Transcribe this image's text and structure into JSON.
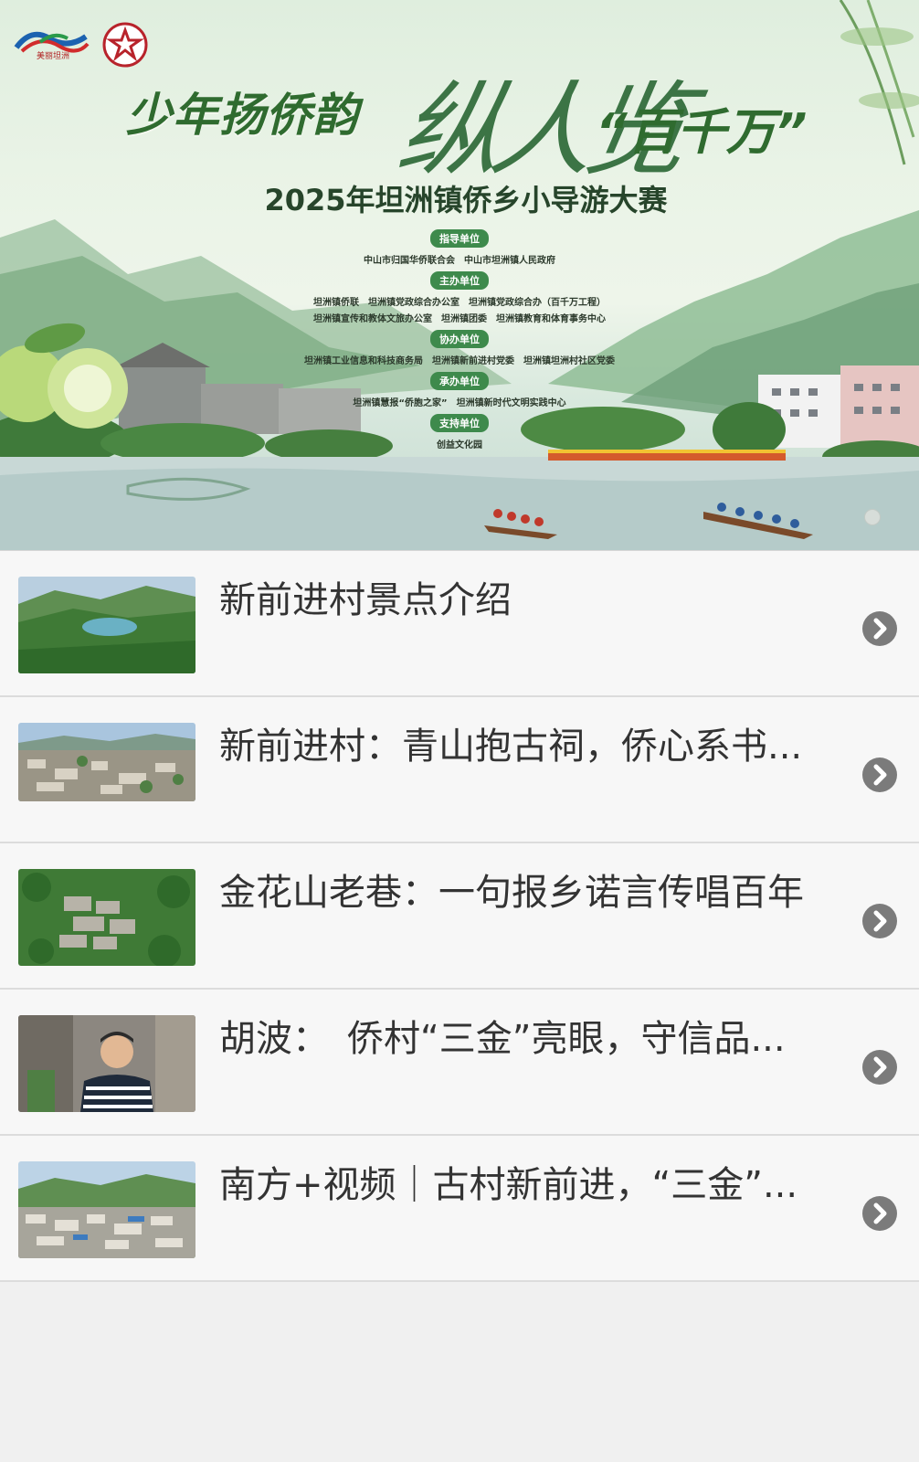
{
  "banner": {
    "logo_a_text": "美丽坦洲",
    "headline_left": "少年扬侨韵",
    "headline_brush": "纵人览",
    "headline_right": "“百千万”",
    "subtitle": "2025年坦洲镇侨乡小导游大赛",
    "orgs": [
      {
        "label": "指导单位",
        "lines": [
          "中山市归国华侨联合会　中山市坦洲镇人民政府"
        ]
      },
      {
        "label": "主办单位",
        "lines": [
          "坦洲镇侨联　坦洲镇党政综合办公室　坦洲镇党政综合办（百千万工程）",
          "坦洲镇宣传和教体文旅办公室　坦洲镇团委　坦洲镇教育和体育事务中心"
        ]
      },
      {
        "label": "协办单位",
        "lines": [
          "坦洲镇工业信息和科技商务局　坦洲镇新前进村党委　坦洲镇坦洲村社区党委"
        ]
      },
      {
        "label": "承办单位",
        "lines": [
          "坦洲镇慧报“侨胞之家”　坦洲镇新时代文明实践中心"
        ]
      },
      {
        "label": "支持单位",
        "lines": [
          "创益文化园"
        ]
      }
    ]
  },
  "list": {
    "items": [
      {
        "title": "新前进村景点介绍",
        "thumb": "mountain-reservoir"
      },
      {
        "title": "新前进村：青山抱古祠，侨心系书...",
        "thumb": "town-aerial"
      },
      {
        "title": "金花山老巷：一句报乡诺言传唱百年",
        "thumb": "village-aerial"
      },
      {
        "title": "胡波：　侨村“三金”亮眼，守信品...",
        "thumb": "man-portrait"
      },
      {
        "title": "南方+视频｜古村新前进，“三金”...",
        "thumb": "town-panorama"
      }
    ]
  },
  "colors": {
    "accent_green": "#3e8a4c",
    "text_dark": "#333333",
    "chevron_gray": "#7b7b7b"
  }
}
